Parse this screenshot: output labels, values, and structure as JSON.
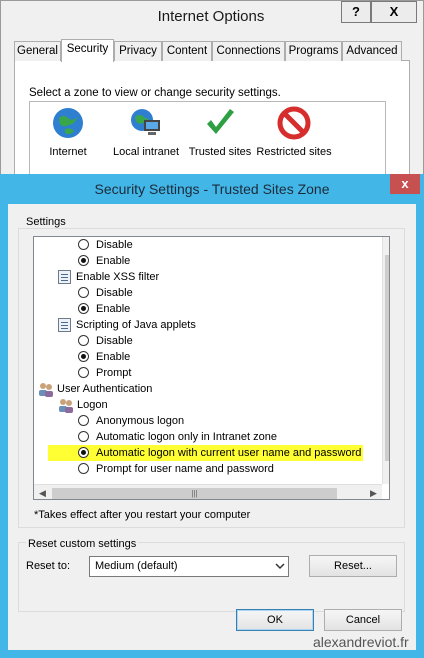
{
  "internet_options": {
    "title": "Internet Options",
    "help_button": "?",
    "close_button": "X",
    "tabs": [
      "General",
      "Security",
      "Privacy",
      "Content",
      "Connections",
      "Programs",
      "Advanced"
    ],
    "active_tab": "Security",
    "zone_prompt": "Select a zone to view or change security settings.",
    "zones": [
      {
        "label": "Internet",
        "icon": "globe-icon"
      },
      {
        "label": "Local intranet",
        "icon": "intranet-icon"
      },
      {
        "label": "Trusted sites",
        "icon": "checkmark-icon"
      },
      {
        "label": "Restricted sites",
        "icon": "restricted-icon"
      }
    ]
  },
  "dialog": {
    "title": "Security Settings - Trusted Sites Zone",
    "close_button": "x",
    "settings_label": "Settings",
    "tree": [
      {
        "type": "radio",
        "label": "Disable",
        "checked": false
      },
      {
        "type": "radio",
        "label": "Enable",
        "checked": true
      },
      {
        "type": "setting",
        "label": "Enable XSS filter"
      },
      {
        "type": "radio",
        "label": "Disable",
        "checked": false
      },
      {
        "type": "radio",
        "label": "Enable",
        "checked": true
      },
      {
        "type": "setting",
        "label": "Scripting of Java applets"
      },
      {
        "type": "radio",
        "label": "Disable",
        "checked": false
      },
      {
        "type": "radio",
        "label": "Enable",
        "checked": true
      },
      {
        "type": "radio",
        "label": "Prompt",
        "checked": false
      },
      {
        "type": "category",
        "label": "User Authentication"
      },
      {
        "type": "subcategory",
        "label": "Logon"
      },
      {
        "type": "radio",
        "label": "Anonymous logon",
        "checked": false
      },
      {
        "type": "radio",
        "label": "Automatic logon only in Intranet zone",
        "checked": false
      },
      {
        "type": "radio",
        "label": "Automatic logon with current user name and password",
        "checked": true,
        "highlighted": true
      },
      {
        "type": "radio",
        "label": "Prompt for user name and password",
        "checked": false
      }
    ],
    "scroll_arrows": {
      "up": "▲",
      "down": "▼",
      "left": "◀",
      "right": "▶",
      "grip": "|||"
    },
    "note": "*Takes effect after you restart your computer",
    "reset_group_label": "Reset custom settings",
    "reset_to_label": "Reset to:",
    "reset_select_value": "Medium (default)",
    "reset_button": "Reset...",
    "ok_button": "OK",
    "cancel_button": "Cancel",
    "highlight_color": "#ffff33"
  },
  "watermark": "alexandreviot.fr"
}
